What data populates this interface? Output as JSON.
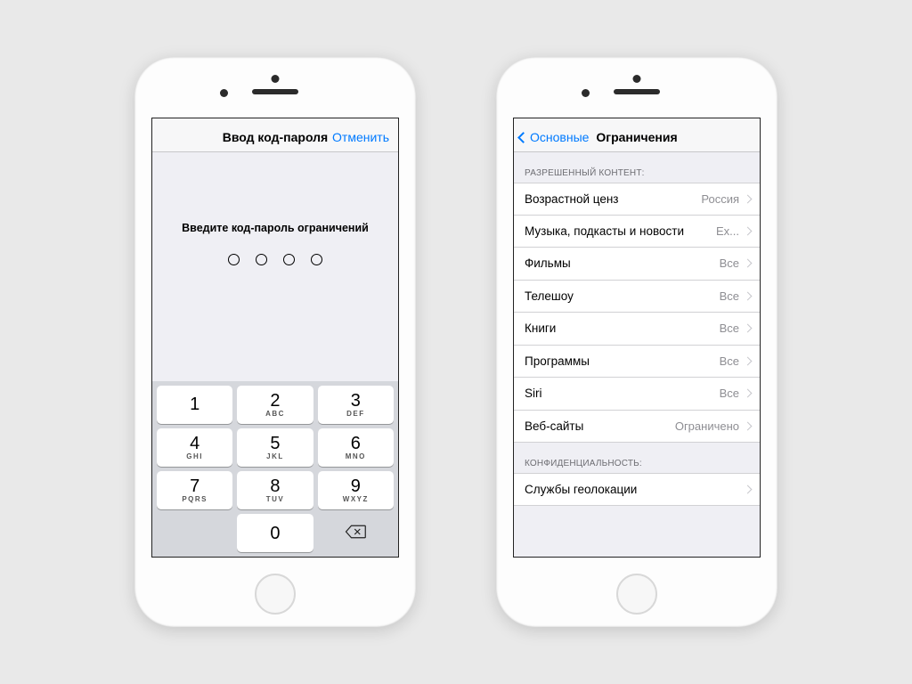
{
  "passcode": {
    "nav_title": "Ввод код-пароля",
    "cancel": "Отменить",
    "prompt": "Введите код-пароль ограничений",
    "keys": [
      {
        "num": "1",
        "sub": ""
      },
      {
        "num": "2",
        "sub": "ABC"
      },
      {
        "num": "3",
        "sub": "DEF"
      },
      {
        "num": "4",
        "sub": "GHI"
      },
      {
        "num": "5",
        "sub": "JKL"
      },
      {
        "num": "6",
        "sub": "MNO"
      },
      {
        "num": "7",
        "sub": "PQRS"
      },
      {
        "num": "8",
        "sub": "TUV"
      },
      {
        "num": "9",
        "sub": "WXYZ"
      }
    ],
    "zero": "0"
  },
  "restrictions": {
    "back": "Основные",
    "title": "Ограничения",
    "sections": [
      {
        "header": "РАЗРЕШЕННЫЙ КОНТЕНТ:",
        "rows": [
          {
            "label": "Возрастной ценз",
            "value": "Россия"
          },
          {
            "label": "Музыка, подкасты и новости",
            "value": "Ex..."
          },
          {
            "label": "Фильмы",
            "value": "Все"
          },
          {
            "label": "Телешоу",
            "value": "Все"
          },
          {
            "label": "Книги",
            "value": "Все"
          },
          {
            "label": "Программы",
            "value": "Все"
          },
          {
            "label": "Siri",
            "value": "Все"
          },
          {
            "label": "Веб-сайты",
            "value": "Ограничено"
          }
        ]
      },
      {
        "header": "КОНФИДЕНЦИАЛЬНОСТЬ:",
        "rows": [
          {
            "label": "Службы геолокации",
            "value": ""
          }
        ]
      }
    ]
  }
}
